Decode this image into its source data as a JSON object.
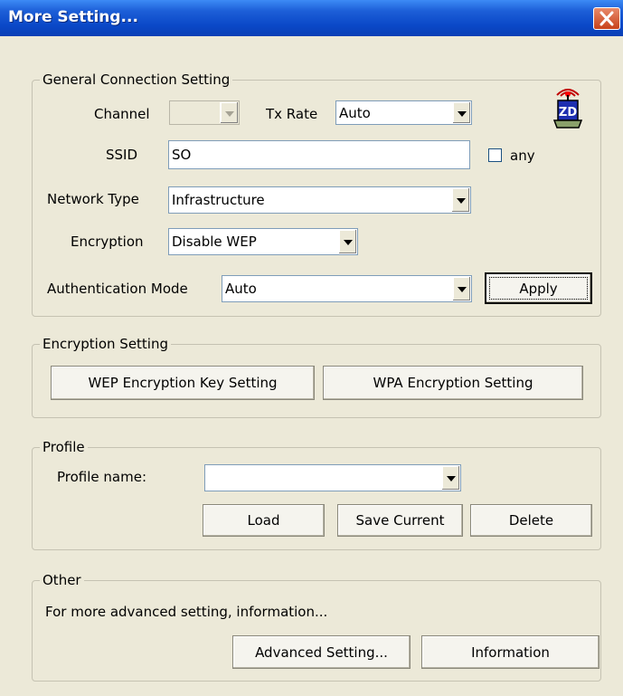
{
  "window": {
    "title": "More Setting..."
  },
  "general": {
    "legend": "General Connection Setting",
    "channel_label": "Channel",
    "channel_value": "",
    "txrate_label": "Tx Rate",
    "txrate_value": "Auto",
    "ssid_label": "SSID",
    "ssid_value": "SO",
    "any_label": "any",
    "any_checked": false,
    "network_type_label": "Network Type",
    "network_type_value": "Infrastructure",
    "encryption_label": "Encryption",
    "encryption_value": "Disable WEP",
    "auth_label": "Authentication Mode",
    "auth_value": "Auto",
    "apply_label": "Apply",
    "icon_text": "ZD"
  },
  "encryption_setting": {
    "legend": "Encryption Setting",
    "wep_button": "WEP Encryption Key Setting",
    "wpa_button": "WPA Encryption Setting"
  },
  "profile": {
    "legend": "Profile",
    "name_label": "Profile name:",
    "name_value": "",
    "load_button": "Load",
    "save_button": "Save Current",
    "delete_button": "Delete"
  },
  "other": {
    "legend": "Other",
    "description": "For more advanced setting, information...",
    "advanced_button": "Advanced Setting...",
    "information_button": "Information"
  },
  "colors": {
    "titlebar": "#0a48c8",
    "dialog_bg": "#ece9d8",
    "close_button": "#c8421a"
  },
  "icons": [
    "close-icon",
    "dropdown-arrow-icon",
    "wireless-device-icon"
  ]
}
